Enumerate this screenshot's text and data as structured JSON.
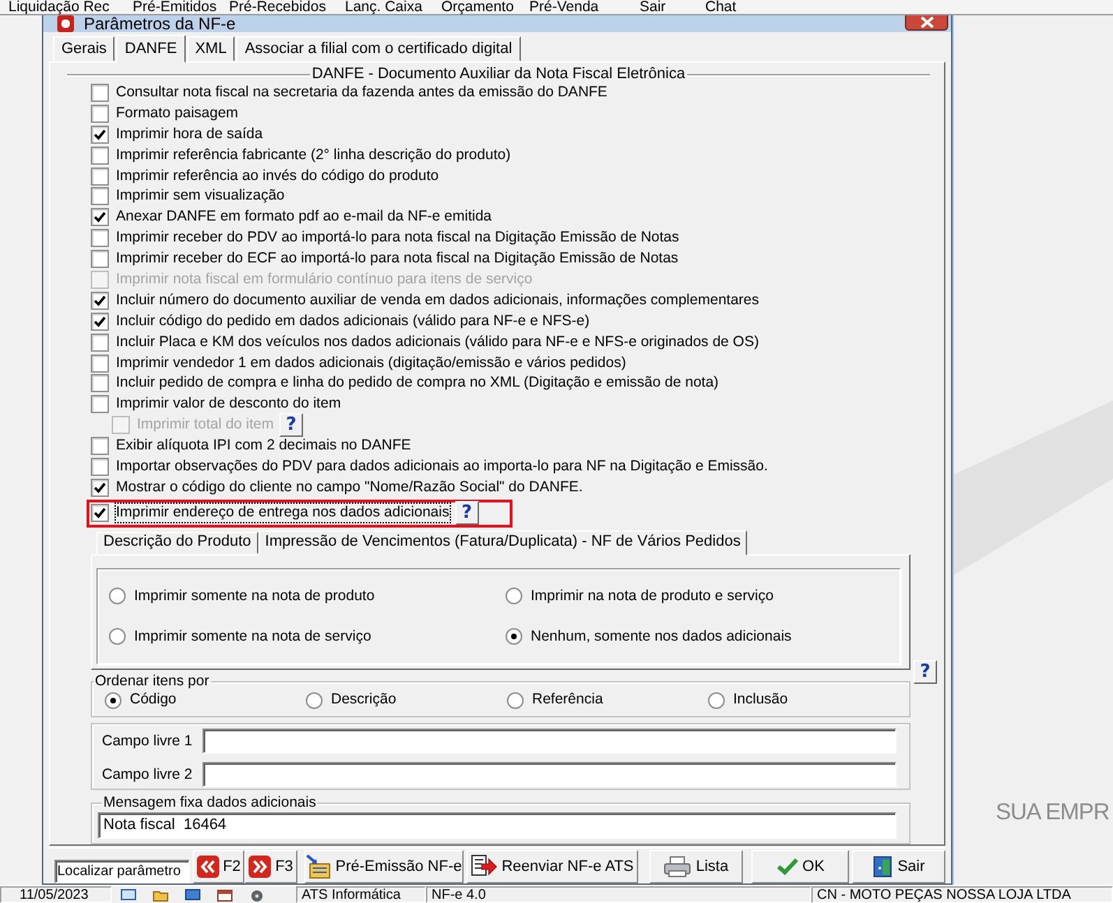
{
  "app_menu": [
    "Liquidação Rec",
    "Pré-Emitidos",
    "Pré-Recebidos",
    "Lanç. Caixa",
    "Orçamento",
    "Pré-Venda",
    "Sair",
    "Chat"
  ],
  "window": {
    "title": "Parâmetros da NF-e"
  },
  "tabs": [
    {
      "label": "Gerais",
      "selected": false
    },
    {
      "label": "DANFE",
      "selected": true
    },
    {
      "label": "XML",
      "selected": false
    },
    {
      "label": "Associar a filial com o certificado digital",
      "selected": false
    }
  ],
  "danfe": {
    "title": "DANFE - Documento Auxiliar da Nota Fiscal Eletrônica",
    "options": [
      {
        "label": "Consultar nota fiscal na secretaria da fazenda antes da emissão do DANFE",
        "checked": false,
        "disabled": false,
        "focused": false,
        "highlighted": false
      },
      {
        "label": "Formato paisagem",
        "checked": false,
        "disabled": false,
        "focused": false,
        "highlighted": false
      },
      {
        "label": "Imprimir hora de saída",
        "checked": true,
        "disabled": false,
        "focused": false,
        "highlighted": false
      },
      {
        "label": "Imprimir referência fabricante (2° linha descrição do produto)",
        "checked": false,
        "disabled": false,
        "focused": false,
        "highlighted": false
      },
      {
        "label": "Imprimir referência ao invés do código do produto",
        "checked": false,
        "disabled": false,
        "focused": false,
        "highlighted": false
      },
      {
        "label": "Imprimir sem visualização",
        "checked": false,
        "disabled": false,
        "focused": false,
        "highlighted": false
      },
      {
        "label": "Anexar DANFE em formato pdf ao e-mail da NF-e emitida",
        "checked": true,
        "disabled": false,
        "focused": false,
        "highlighted": false
      },
      {
        "label": "Imprimir receber do PDV ao importá-lo para nota fiscal na Digitação Emissão de Notas",
        "checked": false,
        "disabled": false,
        "focused": false,
        "highlighted": false
      },
      {
        "label": "Imprimir receber do ECF ao importá-lo para nota fiscal na Digitação Emissão de Notas",
        "checked": false,
        "disabled": false,
        "focused": false,
        "highlighted": false
      },
      {
        "label": "Imprimir nota fiscal em formulário contínuo para itens de serviço",
        "checked": false,
        "disabled": true,
        "focused": false,
        "highlighted": false
      },
      {
        "label": "Incluir número do documento auxiliar de venda em dados adicionais, informações complementares",
        "checked": true,
        "disabled": false,
        "focused": false,
        "highlighted": false
      },
      {
        "label": "Incluir código do pedido em dados adicionais (válido para NF-e e NFS-e)",
        "checked": true,
        "disabled": false,
        "focused": false,
        "highlighted": false
      },
      {
        "label": "Incluir Placa e KM dos veículos nos dados adicionais (válido para NF-e e NFS-e originados de OS)",
        "checked": false,
        "disabled": false,
        "focused": false,
        "highlighted": false
      },
      {
        "label": "Imprimir vendedor 1 em dados adicionais (digitação/emissão e vários pedidos)",
        "checked": false,
        "disabled": false,
        "focused": false,
        "highlighted": false
      },
      {
        "label": "Incluir pedido de compra e linha do pedido de compra no XML (Digitação e emissão de nota)",
        "checked": false,
        "disabled": false,
        "focused": false,
        "highlighted": false
      },
      {
        "label": "Imprimir valor de desconto do item",
        "checked": false,
        "disabled": false,
        "focused": false,
        "highlighted": false,
        "children": [
          {
            "label": "Imprimir total do item",
            "checked": false,
            "disabled": true,
            "focused": false,
            "highlighted": false,
            "help": "?"
          }
        ]
      },
      {
        "label": "Exibir alíquota IPI com 2 decimais no DANFE",
        "checked": false,
        "disabled": false,
        "focused": false,
        "highlighted": false
      },
      {
        "label": "Importar observações do PDV para dados adicionais ao importa-lo para NF na Digitação e Emissão.",
        "checked": false,
        "disabled": false,
        "focused": false,
        "highlighted": false
      },
      {
        "label": "Mostrar o código do cliente no campo \"Nome/Razão Social\" do DANFE.",
        "checked": true,
        "disabled": false,
        "focused": false,
        "highlighted": false
      },
      {
        "label": "Imprimir endereço de entrega nos dados adicionais",
        "checked": true,
        "disabled": false,
        "focused": true,
        "highlighted": true,
        "help": "?"
      }
    ]
  },
  "sub_tabs": [
    {
      "label": "Descrição do Produto",
      "selected": false
    },
    {
      "label": "Impressão de Vencimentos (Fatura/Duplicata) - NF de Vários Pedidos",
      "selected": true
    }
  ],
  "billing_print": {
    "options": [
      {
        "label": "Imprimir somente na nota de produto",
        "selected": false
      },
      {
        "label": "Imprimir na nota de produto e serviço",
        "selected": false
      },
      {
        "label": "Imprimir somente na nota de serviço",
        "selected": false
      },
      {
        "label": "Nenhum, somente nos dados adicionais",
        "selected": true
      }
    ],
    "help": "?"
  },
  "sort_items": {
    "title": "Ordenar itens por",
    "options": [
      {
        "label": "Código",
        "selected": true
      },
      {
        "label": "Descrição",
        "selected": false
      },
      {
        "label": "Referência",
        "selected": false
      },
      {
        "label": "Inclusão",
        "selected": false
      }
    ]
  },
  "free_fields": [
    {
      "label": "Campo livre 1"
    },
    {
      "label": "Campo livre 2"
    }
  ],
  "fixed_message": {
    "title": "Mensagem fixa dados adicionais",
    "value": "Nota fiscal  16464"
  },
  "search": {
    "value": "Localizar parâmetro"
  },
  "buttons": [
    {
      "kind": "prev",
      "label": "F2"
    },
    {
      "kind": "next",
      "label": "F3"
    },
    {
      "kind": "pre_emission",
      "label": "Pré-Emissão NF-e"
    },
    {
      "kind": "resend",
      "label": "Reenviar NF-e ATS"
    },
    {
      "kind": "list",
      "label": "Lista"
    },
    {
      "kind": "ok",
      "label": "OK"
    },
    {
      "kind": "exit",
      "label": "Sair"
    }
  ],
  "status_bar": [
    "11/05/2023",
    "ATS Informática",
    "NF-e 4.0",
    "CN - MOTO PEÇAS NOSSA LOJA LTDA"
  ],
  "background": {
    "brand_text": "SUA EMPR"
  }
}
